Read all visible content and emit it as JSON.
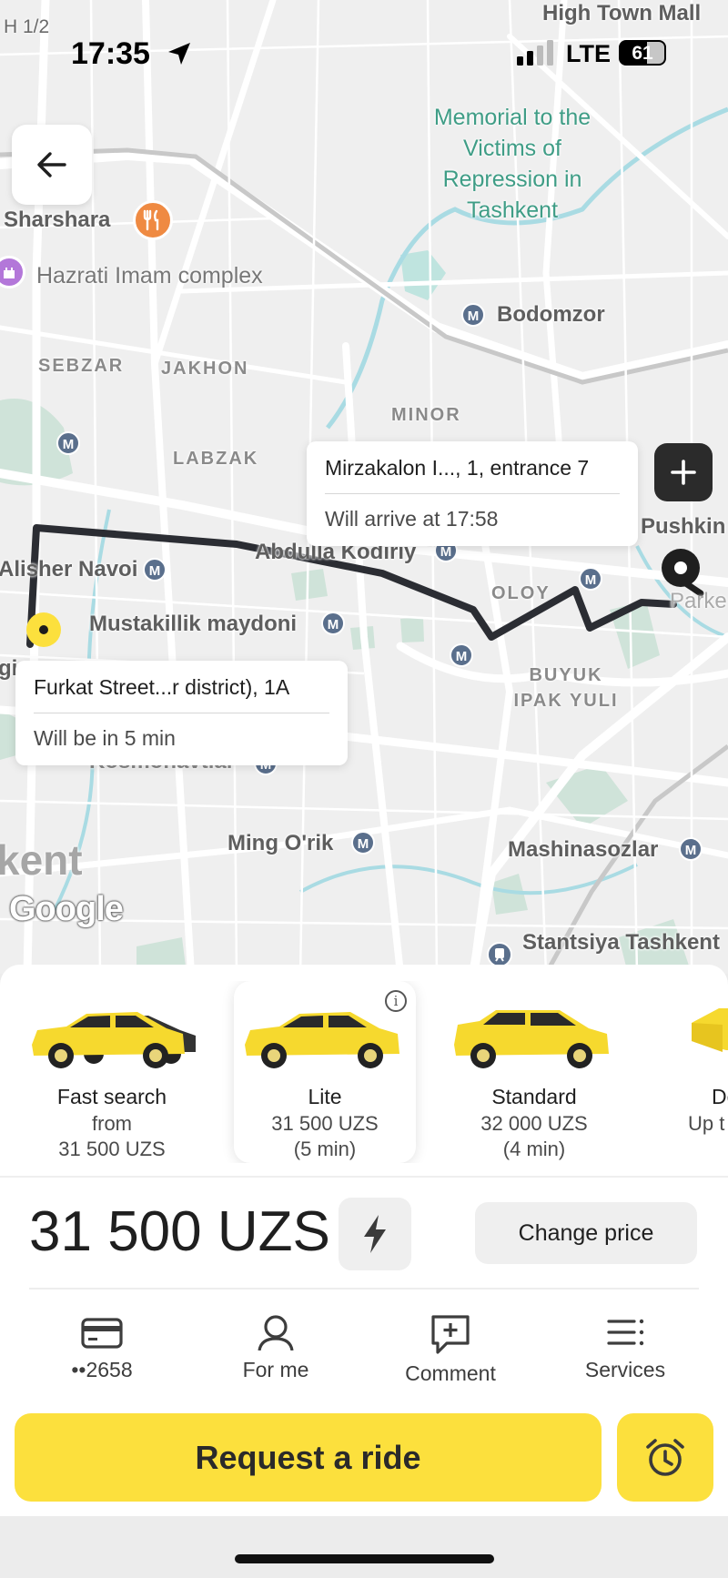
{
  "status_bar": {
    "time": "17:35",
    "network": "LTE",
    "battery": "61",
    "battery_fraction": 0.61
  },
  "map": {
    "labels": {
      "h12": "H 1/2",
      "high_town_mall": "High Town Mall",
      "memorial": "Memorial to the Victims of Repression in Tashkent",
      "sharshara": "Sharshara",
      "hazrati_imam": "Hazrati Imam complex",
      "bodomzor": "Bodomzor",
      "sebzar": "SEBZAR",
      "jakhon": "JAKHON",
      "minor": "MINOR",
      "labzak": "LABZAK",
      "pushkin": "Pushkin",
      "abdulla_kodiriy": "Abdulla Kodiriy",
      "alisher_navoi": "Alisher Navoi",
      "oloy": "OLOY",
      "parke": "Parke",
      "mustakillik": "Mustakillik maydoni",
      "buyuk_ipak_yuli": "BUYUK IPAK YULI",
      "gi": "gi",
      "kosmonavtlar": "Kosmonavtlar",
      "ming_orik": "Ming O'rik",
      "mashinasozlar": "Mashinasozlar",
      "kent": "kent",
      "stantsiya": "Stantsiya Tashkent"
    },
    "metro_symbol": "M",
    "destination": {
      "address": "Mirzakalon I..., 1, entrance 7",
      "eta": "Will arrive at 17:58"
    },
    "pickup": {
      "address": "Furkat Street...r district), 1A",
      "eta": "Will be in 5 min"
    },
    "attribution": "Google"
  },
  "tariffs": [
    {
      "name": "Fast search",
      "price_line1": "from",
      "price_line2": "31 500 UZS",
      "car_color": "#f6d92e",
      "selected": false
    },
    {
      "name": "Lite",
      "price_line1": "31 500 UZS",
      "price_line2": "(5 min)",
      "car_color": "#f6d92e",
      "selected": true
    },
    {
      "name": "Standard",
      "price_line1": "32 000 UZS",
      "price_line2": "(4 min)",
      "car_color": "#f6d92e",
      "selected": false
    },
    {
      "name": "De",
      "price_line1": "Up t",
      "price_line2": "",
      "car_color": "#f6d92e",
      "selected": false
    }
  ],
  "price": {
    "amount": "31 500 UZS",
    "change_label": "Change price"
  },
  "options": {
    "payment": "••2658",
    "for_me": "For me",
    "comment": "Comment",
    "services": "Services"
  },
  "request_label": "Request a ride",
  "colors": {
    "accent": "#fce03d",
    "route": "#2b2d33",
    "pickup_pin": "#fce03d"
  }
}
